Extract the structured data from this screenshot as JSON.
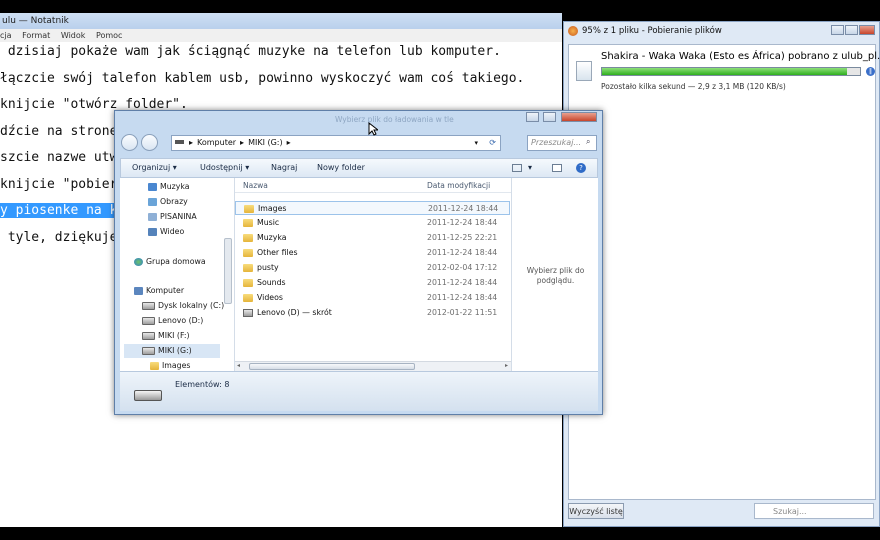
{
  "notepad": {
    "title": "ulu — Notatnik",
    "menu": [
      "cja",
      "Format",
      "Widok",
      "Pomoc"
    ],
    "lines": [
      " dzisiaj pokaże wam jak ściągnąć muzyke na telefon lub komputer.",
      "łączcie swój talefon kablem usb, powinno wyskoczyć wam coś takiego.",
      "knijcie \"otwórz folder\".",
      "dźcie na strone",
      "szcie nazwe utw",
      "knijcie \"pobier",
      "y piosenke na k",
      " tyle, dziękuje"
    ]
  },
  "download": {
    "title": "95% z 1 pliku - Pobieranie plików",
    "filename": "Shakira - Waka Waka (Esto es África) pobrano z ulub_pl.mp3",
    "progress_percent": 95,
    "status": "Pozostało kilka sekund — 2,9 z 3,1 MB (120 KB/s)",
    "clear_label": "Wyczyść listę",
    "search_placeholder": "Szukaj..."
  },
  "explorer": {
    "ghost_title": "Wybierz plik do ładowania w tle",
    "address": [
      "Komputer",
      "MIKI (G:)"
    ],
    "search_placeholder": "Przeszukaj...",
    "toolbar": {
      "organize": "Organizuj",
      "share": "Udostępnij",
      "burn": "Nagraj",
      "new_folder": "Nowy folder"
    },
    "nav": {
      "libraries": [
        "Muzyka",
        "Obrazy",
        "PISANINA",
        "Wideo"
      ],
      "homegroup": "Grupa domowa",
      "computer": "Komputer",
      "drives": [
        "Dysk lokalny (C:)",
        "Lenovo (D:)",
        "MIKI (F:)",
        "MIKI (G:)"
      ],
      "subfolder": "Images"
    },
    "columns": {
      "name": "Nazwa",
      "date": "Data modyfikacji"
    },
    "files": [
      {
        "name": "Images",
        "date": "2011-12-24 18:44",
        "type": "folder"
      },
      {
        "name": "Music",
        "date": "2011-12-24 18:44",
        "type": "folder"
      },
      {
        "name": "Muzyka",
        "date": "2011-12-25 22:21",
        "type": "folder"
      },
      {
        "name": "Other files",
        "date": "2011-12-24 18:44",
        "type": "folder"
      },
      {
        "name": "pusty",
        "date": "2012-02-04 17:12",
        "type": "folder"
      },
      {
        "name": "Sounds",
        "date": "2011-12-24 18:44",
        "type": "folder"
      },
      {
        "name": "Videos",
        "date": "2011-12-24 18:44",
        "type": "folder"
      },
      {
        "name": "Lenovo (D) — skrót",
        "date": "2012-01-22 11:51",
        "type": "shortcut"
      }
    ],
    "preview_text": "Wybierz plik do podglądu.",
    "status_count": "Elementów: 8"
  },
  "colors": {
    "selection": "#3399ff",
    "progress": "#2fae1e",
    "folder": "#e5b53b",
    "window_frame": "#c6daf0"
  }
}
